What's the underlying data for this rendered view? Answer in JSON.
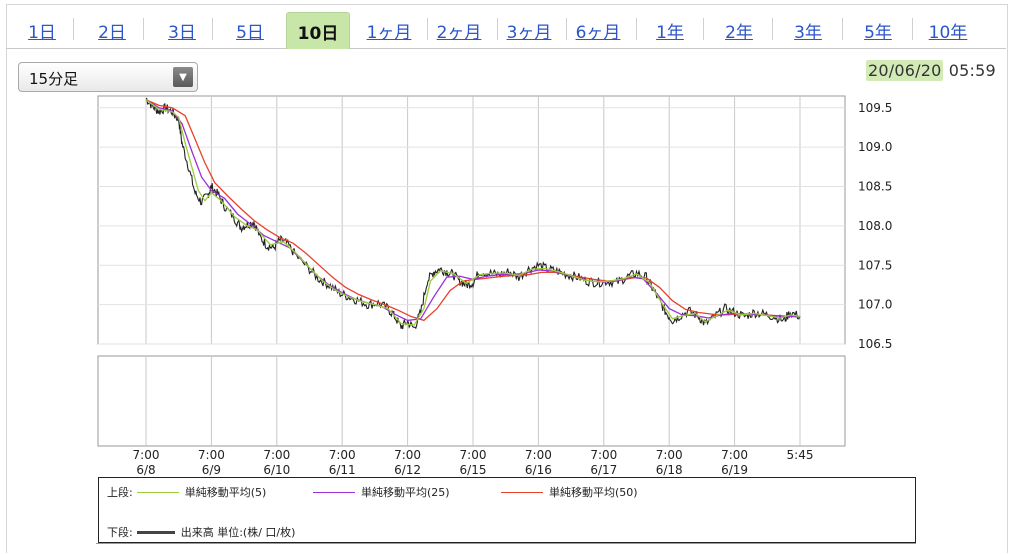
{
  "tabs": [
    {
      "label": "1日"
    },
    {
      "label": "2日"
    },
    {
      "label": "3日"
    },
    {
      "label": "5日"
    },
    {
      "label": "10日"
    },
    {
      "label": "1ヶ月"
    },
    {
      "label": "2ヶ月"
    },
    {
      "label": "3ヶ月"
    },
    {
      "label": "6ヶ月"
    },
    {
      "label": "1年"
    },
    {
      "label": "2年"
    },
    {
      "label": "3年"
    },
    {
      "label": "5年"
    },
    {
      "label": "10年"
    }
  ],
  "active_tab": "10日",
  "interval_select": {
    "value": "15分足"
  },
  "datetime": {
    "date": "20/06/20",
    "time": "05:59"
  },
  "colors": {
    "highlight": "#c9e6a9",
    "ma5": "#9ccc3c",
    "ma25": "#9b30d9",
    "ma50": "#e8412c",
    "price": "#222222",
    "grid": "#c8c8c8",
    "link": "#2b55c9"
  },
  "chart_data": {
    "type": "line",
    "ylim": [
      106.5,
      109.65
    ],
    "yticks": [
      "109.5",
      "109.0",
      "108.5",
      "108.0",
      "107.5",
      "107.0",
      "106.5"
    ],
    "xticks": [
      {
        "time": "7:00",
        "date": "6/8"
      },
      {
        "time": "7:00",
        "date": "6/9"
      },
      {
        "time": "7:00",
        "date": "6/10"
      },
      {
        "time": "7:00",
        "date": "6/11"
      },
      {
        "time": "7:00",
        "date": "6/12"
      },
      {
        "time": "7:00",
        "date": "6/15"
      },
      {
        "time": "7:00",
        "date": "6/16"
      },
      {
        "time": "7:00",
        "date": "6/17"
      },
      {
        "time": "7:00",
        "date": "6/18"
      },
      {
        "time": "7:00",
        "date": "6/19"
      },
      {
        "time": "5:45",
        "date": ""
      }
    ],
    "series": [
      {
        "name": "単純移動平均(5)",
        "key": "ma5"
      },
      {
        "name": "単純移動平均(25)",
        "key": "ma25"
      },
      {
        "name": "単純移動平均(50)",
        "key": "ma50"
      }
    ],
    "price": [
      [
        0.0,
        109.62
      ],
      [
        0.1,
        109.52
      ],
      [
        0.2,
        109.45
      ],
      [
        0.3,
        109.5
      ],
      [
        0.4,
        109.45
      ],
      [
        0.5,
        109.35
      ],
      [
        0.55,
        109.05
      ],
      [
        0.65,
        108.75
      ],
      [
        0.75,
        108.42
      ],
      [
        0.85,
        108.3
      ],
      [
        0.95,
        108.4
      ],
      [
        1.0,
        108.5
      ],
      [
        1.1,
        108.4
      ],
      [
        1.2,
        108.25
      ],
      [
        1.35,
        108.1
      ],
      [
        1.45,
        107.98
      ],
      [
        1.55,
        108.02
      ],
      [
        1.65,
        108.05
      ],
      [
        1.75,
        107.85
      ],
      [
        1.85,
        107.75
      ],
      [
        1.95,
        107.72
      ],
      [
        2.05,
        107.82
      ],
      [
        2.15,
        107.78
      ],
      [
        2.3,
        107.62
      ],
      [
        2.5,
        107.45
      ],
      [
        2.65,
        107.32
      ],
      [
        2.8,
        107.25
      ],
      [
        2.95,
        107.15
      ],
      [
        3.1,
        107.1
      ],
      [
        3.25,
        107.05
      ],
      [
        3.4,
        107.0
      ],
      [
        3.55,
        107.02
      ],
      [
        3.7,
        106.95
      ],
      [
        3.8,
        106.85
      ],
      [
        3.9,
        106.72
      ],
      [
        4.0,
        106.78
      ],
      [
        4.1,
        106.7
      ],
      [
        4.2,
        106.9
      ],
      [
        4.3,
        107.3
      ],
      [
        4.4,
        107.42
      ],
      [
        4.5,
        107.45
      ],
      [
        4.6,
        107.42
      ],
      [
        4.7,
        107.38
      ],
      [
        4.8,
        107.3
      ],
      [
        4.9,
        107.25
      ],
      [
        5.0,
        107.28
      ],
      [
        5.1,
        107.42
      ],
      [
        5.25,
        107.4
      ],
      [
        5.4,
        107.38
      ],
      [
        5.55,
        107.42
      ],
      [
        5.7,
        107.35
      ],
      [
        5.85,
        107.45
      ],
      [
        6.0,
        107.5
      ],
      [
        6.15,
        107.45
      ],
      [
        6.3,
        107.42
      ],
      [
        6.45,
        107.38
      ],
      [
        6.6,
        107.35
      ],
      [
        6.75,
        107.3
      ],
      [
        6.9,
        107.28
      ],
      [
        7.05,
        107.3
      ],
      [
        7.2,
        107.28
      ],
      [
        7.35,
        107.35
      ],
      [
        7.5,
        107.4
      ],
      [
        7.65,
        107.35
      ],
      [
        7.75,
        107.2
      ],
      [
        7.85,
        107.05
      ],
      [
        7.95,
        106.9
      ],
      [
        8.05,
        106.8
      ],
      [
        8.15,
        106.85
      ],
      [
        8.3,
        106.92
      ],
      [
        8.45,
        106.85
      ],
      [
        8.55,
        106.75
      ],
      [
        8.7,
        106.85
      ],
      [
        8.85,
        106.95
      ],
      [
        9.0,
        106.9
      ],
      [
        9.15,
        106.85
      ],
      [
        9.3,
        106.9
      ],
      [
        9.45,
        106.88
      ],
      [
        9.6,
        106.85
      ],
      [
        9.75,
        106.8
      ],
      [
        9.85,
        106.9
      ],
      [
        10.0,
        106.85
      ]
    ],
    "ma5": [
      [
        0.0,
        109.6
      ],
      [
        0.2,
        109.48
      ],
      [
        0.4,
        109.45
      ],
      [
        0.5,
        109.38
      ],
      [
        0.6,
        109.05
      ],
      [
        0.7,
        108.75
      ],
      [
        0.8,
        108.45
      ],
      [
        0.9,
        108.32
      ],
      [
        1.0,
        108.42
      ],
      [
        1.15,
        108.32
      ],
      [
        1.35,
        108.12
      ],
      [
        1.55,
        108.0
      ],
      [
        1.7,
        107.95
      ],
      [
        1.9,
        107.76
      ],
      [
        2.1,
        107.8
      ],
      [
        2.3,
        107.65
      ],
      [
        2.5,
        107.47
      ],
      [
        2.7,
        107.3
      ],
      [
        2.9,
        107.18
      ],
      [
        3.1,
        107.1
      ],
      [
        3.3,
        107.04
      ],
      [
        3.5,
        107.0
      ],
      [
        3.7,
        106.95
      ],
      [
        3.9,
        106.76
      ],
      [
        4.1,
        106.74
      ],
      [
        4.25,
        106.95
      ],
      [
        4.35,
        107.3
      ],
      [
        4.5,
        107.43
      ],
      [
        4.7,
        107.39
      ],
      [
        4.9,
        107.27
      ],
      [
        5.1,
        107.38
      ],
      [
        5.3,
        107.4
      ],
      [
        5.5,
        107.4
      ],
      [
        5.7,
        107.37
      ],
      [
        5.9,
        107.45
      ],
      [
        6.1,
        107.46
      ],
      [
        6.3,
        107.42
      ],
      [
        6.5,
        107.37
      ],
      [
        6.7,
        107.31
      ],
      [
        6.9,
        107.29
      ],
      [
        7.1,
        107.3
      ],
      [
        7.3,
        107.33
      ],
      [
        7.5,
        107.39
      ],
      [
        7.7,
        107.28
      ],
      [
        7.9,
        107.0
      ],
      [
        8.05,
        106.82
      ],
      [
        8.2,
        106.86
      ],
      [
        8.4,
        106.89
      ],
      [
        8.55,
        106.78
      ],
      [
        8.7,
        106.85
      ],
      [
        8.9,
        106.93
      ],
      [
        9.1,
        106.87
      ],
      [
        9.3,
        106.89
      ],
      [
        9.5,
        106.86
      ],
      [
        9.7,
        106.83
      ],
      [
        9.85,
        106.87
      ],
      [
        10.0,
        106.85
      ]
    ],
    "ma25": [
      [
        0.0,
        109.6
      ],
      [
        0.2,
        109.5
      ],
      [
        0.4,
        109.46
      ],
      [
        0.55,
        109.3
      ],
      [
        0.7,
        108.95
      ],
      [
        0.85,
        108.62
      ],
      [
        1.0,
        108.45
      ],
      [
        1.2,
        108.35
      ],
      [
        1.4,
        108.15
      ],
      [
        1.6,
        108.02
      ],
      [
        1.8,
        107.88
      ],
      [
        2.0,
        107.8
      ],
      [
        2.2,
        107.72
      ],
      [
        2.4,
        107.55
      ],
      [
        2.6,
        107.38
      ],
      [
        2.8,
        107.25
      ],
      [
        3.0,
        107.15
      ],
      [
        3.2,
        107.07
      ],
      [
        3.4,
        107.02
      ],
      [
        3.6,
        106.98
      ],
      [
        3.8,
        106.88
      ],
      [
        4.0,
        106.8
      ],
      [
        4.2,
        106.82
      ],
      [
        4.4,
        107.1
      ],
      [
        4.6,
        107.35
      ],
      [
        4.8,
        107.36
      ],
      [
        5.0,
        107.32
      ],
      [
        5.2,
        107.36
      ],
      [
        5.4,
        107.38
      ],
      [
        5.6,
        107.38
      ],
      [
        5.8,
        107.4
      ],
      [
        6.0,
        107.44
      ],
      [
        6.2,
        107.43
      ],
      [
        6.4,
        107.39
      ],
      [
        6.6,
        107.34
      ],
      [
        6.8,
        107.3
      ],
      [
        7.0,
        107.29
      ],
      [
        7.2,
        107.3
      ],
      [
        7.4,
        107.35
      ],
      [
        7.6,
        107.33
      ],
      [
        7.8,
        107.15
      ],
      [
        8.0,
        106.95
      ],
      [
        8.2,
        106.87
      ],
      [
        8.4,
        106.86
      ],
      [
        8.6,
        106.83
      ],
      [
        8.8,
        106.87
      ],
      [
        9.0,
        106.89
      ],
      [
        9.2,
        106.88
      ],
      [
        9.4,
        106.87
      ],
      [
        9.6,
        106.86
      ],
      [
        9.8,
        106.85
      ],
      [
        10.0,
        106.85
      ]
    ],
    "ma50": [
      [
        0.0,
        109.6
      ],
      [
        0.2,
        109.53
      ],
      [
        0.4,
        109.5
      ],
      [
        0.6,
        109.4
      ],
      [
        0.75,
        109.1
      ],
      [
        0.9,
        108.8
      ],
      [
        1.05,
        108.55
      ],
      [
        1.25,
        108.38
      ],
      [
        1.45,
        108.22
      ],
      [
        1.65,
        108.07
      ],
      [
        1.85,
        107.95
      ],
      [
        2.05,
        107.85
      ],
      [
        2.25,
        107.78
      ],
      [
        2.45,
        107.65
      ],
      [
        2.65,
        107.5
      ],
      [
        2.85,
        107.35
      ],
      [
        3.05,
        107.22
      ],
      [
        3.25,
        107.13
      ],
      [
        3.45,
        107.06
      ],
      [
        3.65,
        107.0
      ],
      [
        3.85,
        106.93
      ],
      [
        4.05,
        106.85
      ],
      [
        4.25,
        106.8
      ],
      [
        4.45,
        106.95
      ],
      [
        4.65,
        107.18
      ],
      [
        4.85,
        107.3
      ],
      [
        5.05,
        107.32
      ],
      [
        5.25,
        107.34
      ],
      [
        5.45,
        107.36
      ],
      [
        5.65,
        107.37
      ],
      [
        5.85,
        107.38
      ],
      [
        6.05,
        107.41
      ],
      [
        6.25,
        107.41
      ],
      [
        6.45,
        107.38
      ],
      [
        6.65,
        107.35
      ],
      [
        6.85,
        107.32
      ],
      [
        7.05,
        107.3
      ],
      [
        7.25,
        107.31
      ],
      [
        7.45,
        107.34
      ],
      [
        7.65,
        107.34
      ],
      [
        7.85,
        107.22
      ],
      [
        8.05,
        107.05
      ],
      [
        8.25,
        106.94
      ],
      [
        8.45,
        106.9
      ],
      [
        8.65,
        106.88
      ],
      [
        8.85,
        106.87
      ],
      [
        9.05,
        106.88
      ],
      [
        9.25,
        106.88
      ],
      [
        9.45,
        106.87
      ],
      [
        9.65,
        106.86
      ],
      [
        9.85,
        106.85
      ],
      [
        10.0,
        106.84
      ]
    ]
  },
  "legend": {
    "upper_label": "上段:",
    "lower_label": "下段:",
    "ma5": "単純移動平均(5)",
    "ma25": "単純移動平均(25)",
    "ma50": "単純移動平均(50)",
    "volume": "出来高 単位:(株/ 口/枚)"
  }
}
